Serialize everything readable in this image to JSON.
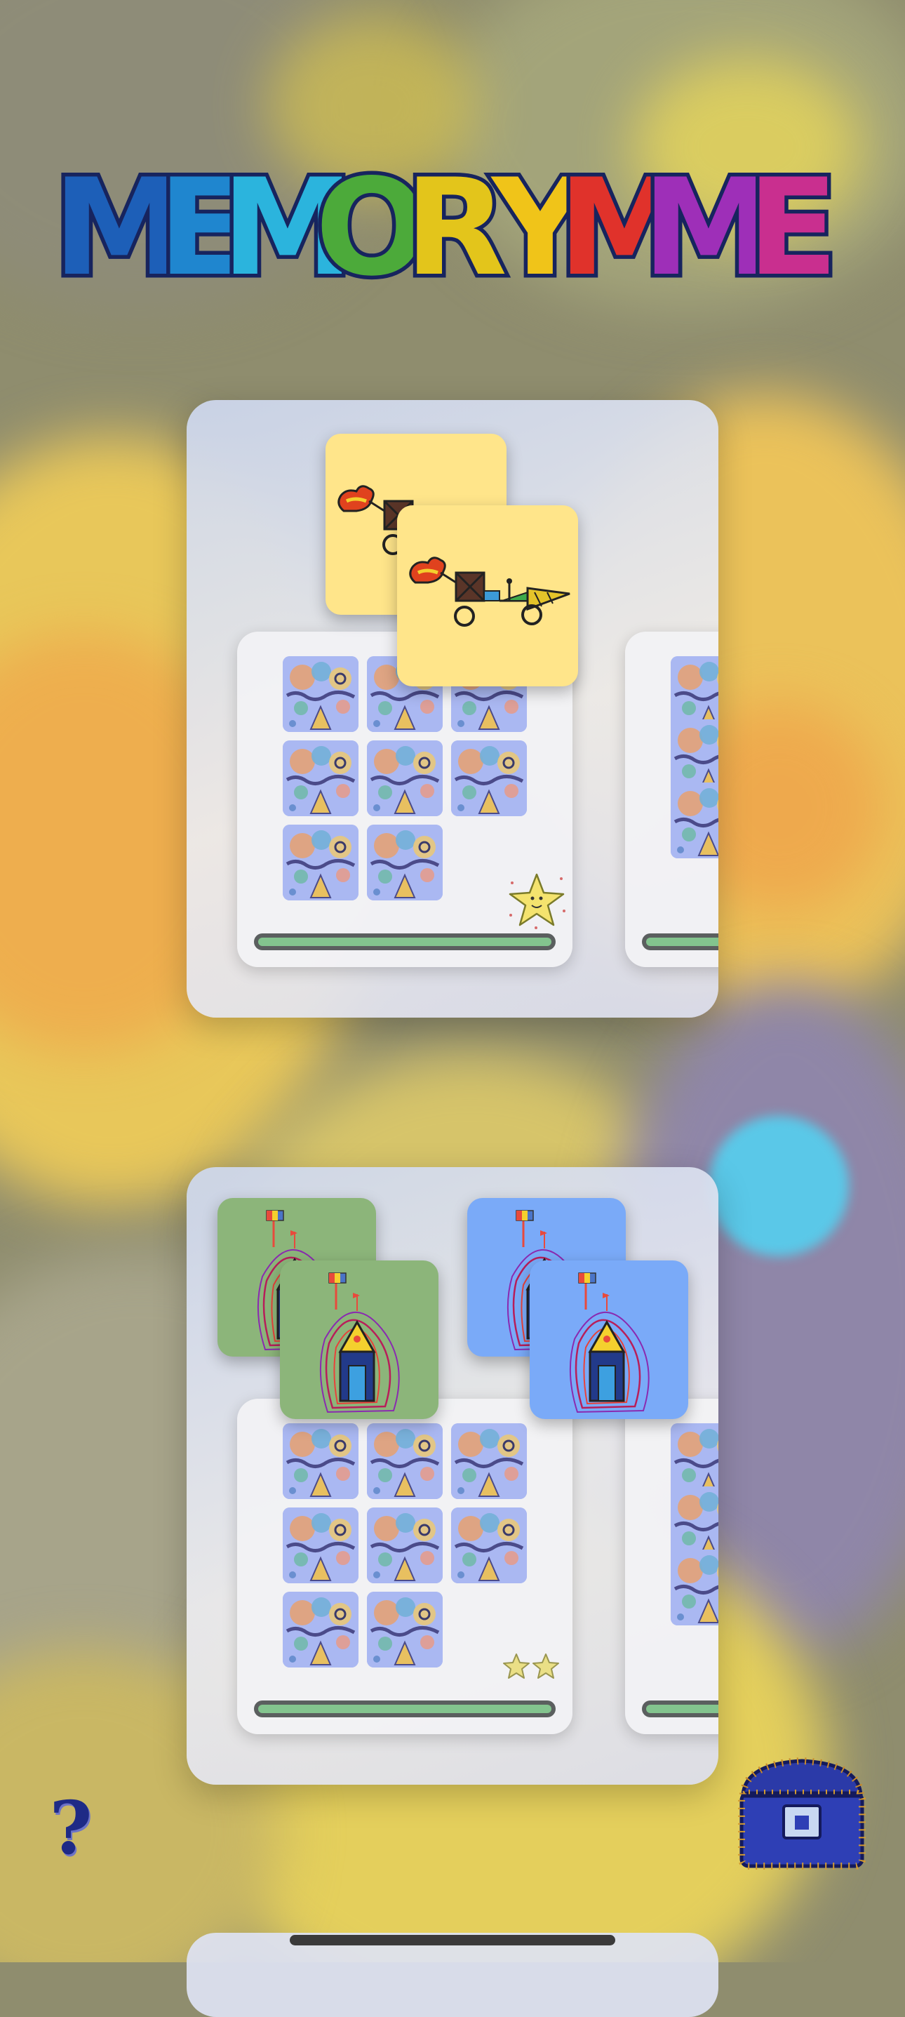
{
  "app": {
    "title": "MEMORYME",
    "title_letters": [
      {
        "ch": "M",
        "color": "#1d5fb8"
      },
      {
        "ch": "E",
        "color": "#1f86cf"
      },
      {
        "ch": "M",
        "color": "#2bb4dd"
      },
      {
        "ch": "O",
        "color": "#4caa3a"
      },
      {
        "ch": "R",
        "color": "#e3c51b"
      },
      {
        "ch": "Y",
        "color": "#f0c419"
      },
      {
        "ch": "M",
        "color": "#e0322b"
      },
      {
        "ch": "M",
        "color": "#9e2fb8"
      },
      {
        "ch": "E",
        "color": "#c92f8f"
      }
    ]
  },
  "levels": [
    {
      "name": "level-1",
      "featured_image": "cart-drawing",
      "card_background": "#ffe58a",
      "thumbnail_count": 8,
      "stars_earned": 1,
      "progress": 1.0
    },
    {
      "name": "level-2",
      "featured_image": "house-drawing",
      "card_backgrounds": [
        "#8cb57a",
        "#7aaaf8"
      ],
      "thumbnail_count": 8,
      "stars_earned": 2,
      "progress": 1.0
    }
  ],
  "footer": {
    "help_label": "?",
    "help_icon": "question-mark-icon",
    "collection_icon": "treasure-chest-icon"
  },
  "colors": {
    "progress_track": "#5b5f5f",
    "progress_fill": "#83c48e",
    "help": "#1e2a86"
  }
}
